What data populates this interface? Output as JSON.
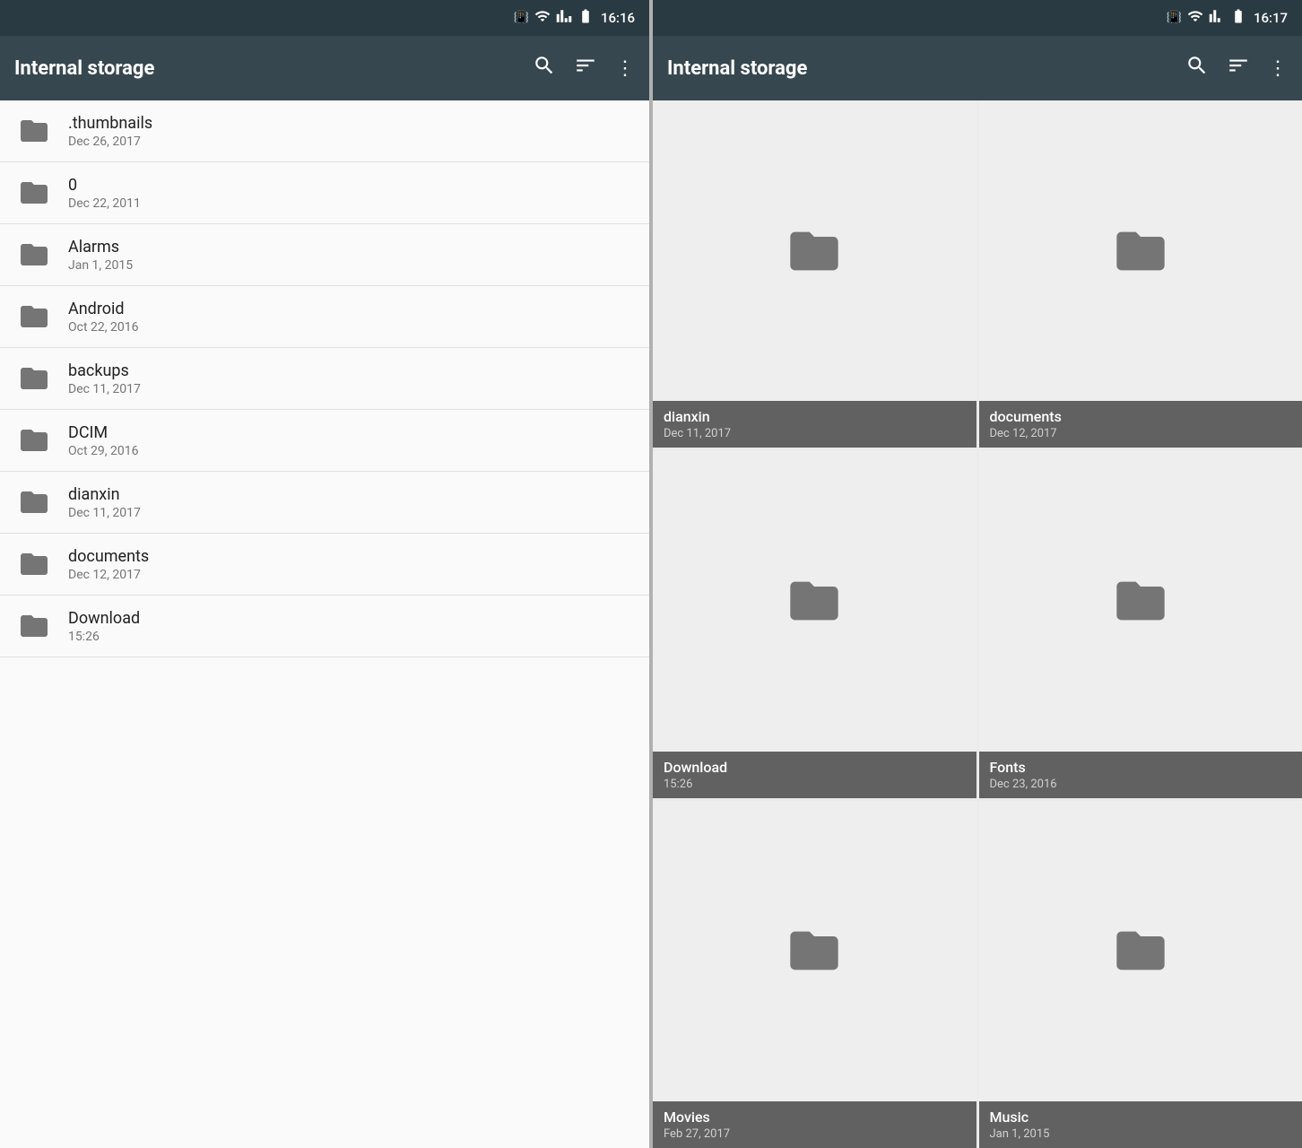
{
  "left_panel": {
    "status": {
      "time": "16:16",
      "icons": [
        "vibrate",
        "wifi",
        "signal",
        "battery"
      ]
    },
    "toolbar": {
      "title": "Internal storage",
      "search_label": "search",
      "sort_label": "sort",
      "more_label": "more"
    },
    "items": [
      {
        "name": ".thumbnails",
        "date": "Dec 26, 2017"
      },
      {
        "name": "0",
        "date": "Dec 22, 2011"
      },
      {
        "name": "Alarms",
        "date": "Jan 1, 2015"
      },
      {
        "name": "Android",
        "date": "Oct 22, 2016"
      },
      {
        "name": "backups",
        "date": "Dec 11, 2017"
      },
      {
        "name": "DCIM",
        "date": "Oct 29, 2016"
      },
      {
        "name": "dianxin",
        "date": "Dec 11, 2017"
      },
      {
        "name": "documents",
        "date": "Dec 12, 2017"
      },
      {
        "name": "Download",
        "date": "15:26"
      }
    ]
  },
  "right_panel": {
    "status": {
      "time": "16:17",
      "icons": [
        "vibrate",
        "wifi",
        "signal",
        "battery"
      ]
    },
    "toolbar": {
      "title": "Internal storage",
      "search_label": "search",
      "sort_label": "sort",
      "more_label": "more"
    },
    "items": [
      {
        "name": "dianxin",
        "date": "Dec 11, 2017"
      },
      {
        "name": "documents",
        "date": "Dec 12, 2017"
      },
      {
        "name": "Download",
        "date": "15:26"
      },
      {
        "name": "Fonts",
        "date": "Dec 23, 2016"
      },
      {
        "name": "Movies",
        "date": "Feb 27, 2017"
      },
      {
        "name": "Music",
        "date": "Jan 1, 2015"
      }
    ]
  }
}
